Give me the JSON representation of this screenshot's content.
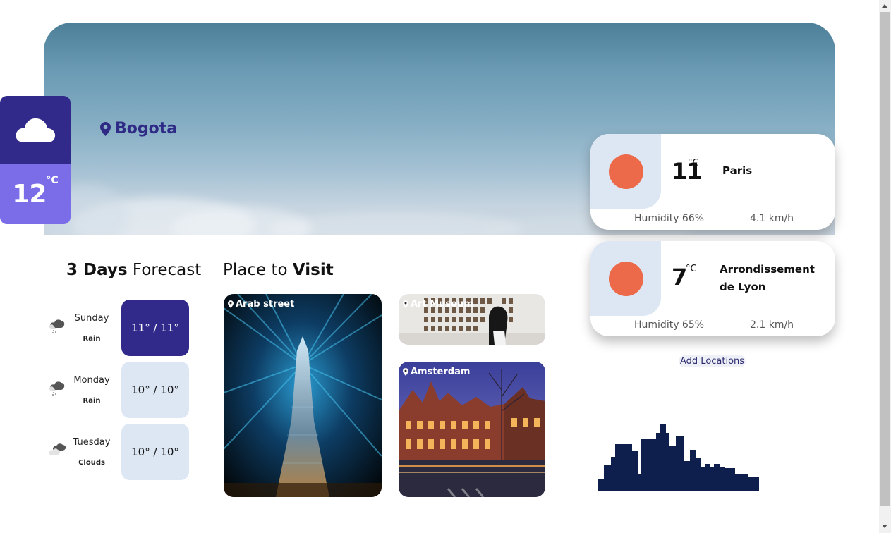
{
  "current": {
    "city": "Bogota",
    "temp": "12",
    "unit": "°C",
    "icon": "cloud-icon"
  },
  "locations": [
    {
      "city": "Paris",
      "temp": "11",
      "unit": "°C",
      "humidity": "Humidity 66%",
      "wind": "4.1 km/h",
      "icon": "sun-icon"
    },
    {
      "city_line1": "Arrondissement",
      "city_line2": "de Lyon",
      "temp": "7",
      "unit": "°C",
      "humidity": "Humidity 65%",
      "wind": "2.1 km/h",
      "icon": "sun-icon"
    }
  ],
  "add_locations_label": "Add Locations",
  "forecast": {
    "title_bold": "3 Days",
    "title_rest": " Forecast",
    "days": [
      {
        "day": "Sunday",
        "desc": "Rain",
        "range": "11° / 11°",
        "icon": "rain-icon",
        "active": true
      },
      {
        "day": "Monday",
        "desc": "Rain",
        "range": "10° / 10°",
        "icon": "rain-icon",
        "active": false
      },
      {
        "day": "Tuesday",
        "desc": "Clouds",
        "range": "10° / 10°",
        "icon": "clouds-icon",
        "active": false
      }
    ]
  },
  "places": {
    "title_rest": "Place to ",
    "title_bold": "Visit",
    "items": [
      {
        "label": "Arab street"
      },
      {
        "label": "Art Museum"
      },
      {
        "label": "Amsterdam"
      }
    ]
  },
  "colors": {
    "primary": "#312a8a",
    "accent": "#7b6ce8",
    "sun": "#ec6a4a",
    "tile": "#dde7f3",
    "skyline": "#0f1f4d"
  }
}
